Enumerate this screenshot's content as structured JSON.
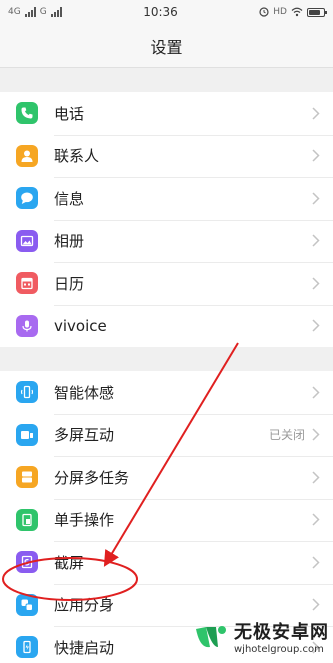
{
  "status_bar": {
    "network_left": "4G",
    "network_right": "G",
    "time": "10:36",
    "hd": "HD"
  },
  "header": {
    "title": "设置"
  },
  "groups": [
    {
      "items": [
        {
          "label": "电话",
          "icon": "phone-icon",
          "color": "#2fc46b"
        },
        {
          "label": "联系人",
          "icon": "contact-icon",
          "color": "#f6a623"
        },
        {
          "label": "信息",
          "icon": "message-icon",
          "color": "#2aa6f0"
        },
        {
          "label": "相册",
          "icon": "album-icon",
          "color": "#8a5cf0"
        },
        {
          "label": "日历",
          "icon": "calendar-icon",
          "color": "#f05b61"
        },
        {
          "label": "vivoice",
          "icon": "voice-icon",
          "color": "#a86af0"
        }
      ]
    },
    {
      "items": [
        {
          "label": "智能体感",
          "icon": "smart-motion-icon",
          "color": "#2aa6f0"
        },
        {
          "label": "多屏互动",
          "icon": "multi-screen-icon",
          "color": "#2aa6f0",
          "status": "已关闭"
        },
        {
          "label": "分屏多任务",
          "icon": "split-screen-icon",
          "color": "#f6a623"
        },
        {
          "label": "单手操作",
          "icon": "one-hand-icon",
          "color": "#2fc46b"
        },
        {
          "label": "截屏",
          "icon": "screenshot-icon",
          "color": "#8a5cf0"
        },
        {
          "label": "应用分身",
          "icon": "app-clone-icon",
          "color": "#2aa6f0"
        },
        {
          "label": "快捷启动",
          "icon": "quick-launch-icon",
          "color": "#2aa6f0"
        }
      ]
    }
  ],
  "annotation": {
    "color": "#e02020"
  },
  "watermark": {
    "title": "无极安卓网",
    "url": "wjhotelgroup.com"
  }
}
